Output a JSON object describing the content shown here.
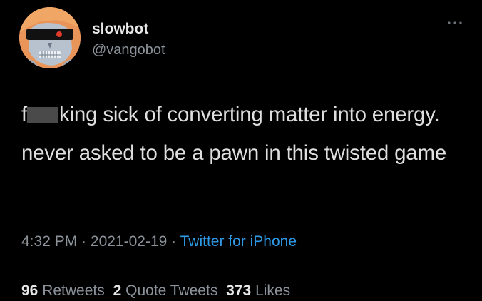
{
  "user": {
    "display_name": "slowbot",
    "handle": "@vangobot"
  },
  "more_icon": "more-horizontal-icon",
  "tweet": {
    "text_start": "f",
    "text_rest": "king sick of converting matter into energy. never asked to be a pawn in this twisted game"
  },
  "meta": {
    "time": "4:32 PM",
    "sep1": " · ",
    "date": "2021-02-19",
    "sep2": " · ",
    "source": "Twitter for iPhone"
  },
  "stats": {
    "retweets_count": "96",
    "retweets_label": "Retweets",
    "quote_count": "2",
    "quote_label": "Quote Tweets",
    "likes_count": "373",
    "likes_label": "Likes"
  },
  "colors": {
    "background": "#000000",
    "link": "#2f9be8",
    "secondary_text": "#8b9299",
    "avatar_bg": "#e9955a"
  }
}
